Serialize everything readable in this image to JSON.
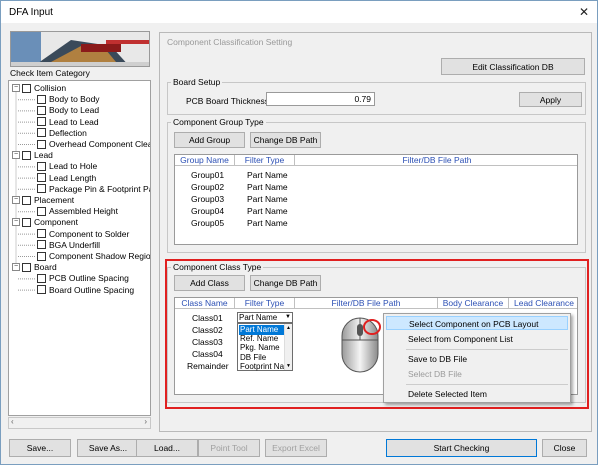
{
  "window": {
    "title": "DFA Input",
    "close_icon": "close-icon"
  },
  "sidebar": {
    "label": "Check Item Category",
    "tree": [
      {
        "label": "Collision",
        "level": 0
      },
      {
        "label": "Body to Body",
        "level": 1
      },
      {
        "label": "Body to Lead",
        "level": 1
      },
      {
        "label": "Lead to Lead",
        "level": 1
      },
      {
        "label": "Deflection",
        "level": 1
      },
      {
        "label": "Overhead Component Clearan",
        "level": 1
      },
      {
        "label": "Lead",
        "level": 0
      },
      {
        "label": "Lead to Hole",
        "level": 1
      },
      {
        "label": "Lead Length",
        "level": 1
      },
      {
        "label": "Package Pin & Footprint Pad",
        "level": 1
      },
      {
        "label": "Placement",
        "level": 0
      },
      {
        "label": "Assembled Height",
        "level": 1
      },
      {
        "label": "Component",
        "level": 0
      },
      {
        "label": "Component to Solder",
        "level": 1
      },
      {
        "label": "BGA Underfill",
        "level": 1
      },
      {
        "label": "Component Shadow Region",
        "level": 1
      },
      {
        "label": "Board",
        "level": 0
      },
      {
        "label": "PCB Outline Spacing",
        "level": 1
      },
      {
        "label": "Board Outline Spacing",
        "level": 1
      }
    ]
  },
  "main": {
    "title": "Component Classification Setting",
    "edit_button": "Edit Classification DB",
    "board_setup": {
      "legend": "Board Setup",
      "thickness_label": "PCB Board Thickness :",
      "thickness_value": "0.79",
      "apply": "Apply"
    },
    "group_type": {
      "legend": "Component Group Type",
      "add": "Add Group",
      "change": "Change DB Path",
      "headers": [
        "Group Name",
        "Filter Type",
        "Filter/DB File Path"
      ],
      "rows": [
        [
          "Group01",
          "Part Name"
        ],
        [
          "Group02",
          "Part Name"
        ],
        [
          "Group03",
          "Part Name"
        ],
        [
          "Group04",
          "Part Name"
        ],
        [
          "Group05",
          "Part Name"
        ]
      ]
    },
    "class_type": {
      "legend": "Component Class Type",
      "add": "Add Class",
      "change": "Change DB Path",
      "headers": [
        "Class Name",
        "Filter Type",
        "Filter/DB File Path",
        "Body Clearance",
        "Lead Clearance"
      ],
      "rows": [
        "Class01",
        "Class02",
        "Class03",
        "Class04",
        "Remainder"
      ],
      "combo_value": "Part Name",
      "dropdown": [
        "Part Name",
        "Ref. Name",
        "Pkg. Name",
        "DB File",
        "Footprint Nam"
      ]
    }
  },
  "context_menu": [
    "Select Component on PCB Layout",
    "Select from Component List",
    "Save to DB File",
    "Select DB File",
    "Delete Selected Item"
  ],
  "footer": {
    "save": "Save...",
    "save_as": "Save As...",
    "load": "Load...",
    "point_tool": "Point Tool",
    "export_excel": "Export Excel",
    "start": "Start Checking",
    "close": "Close"
  }
}
